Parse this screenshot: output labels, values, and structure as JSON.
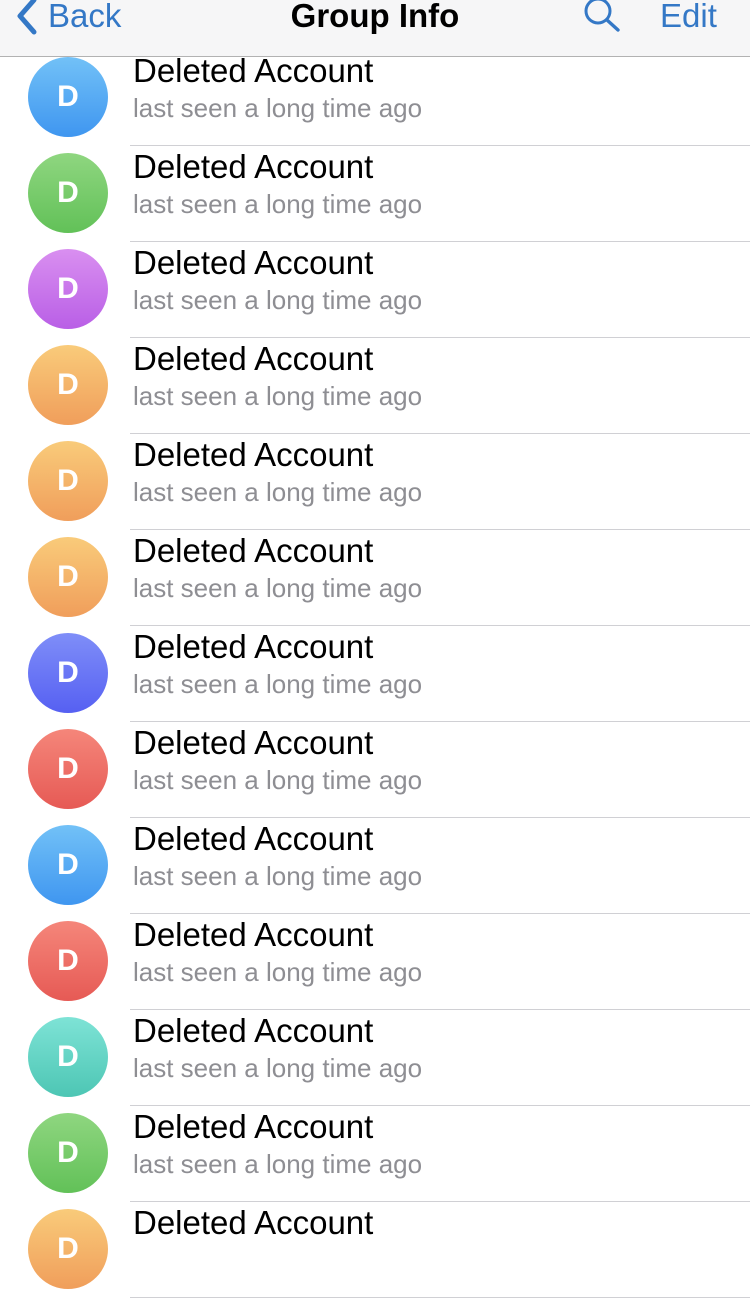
{
  "navbar": {
    "back_label": "Back",
    "title": "Group Info",
    "edit_label": "Edit",
    "accent_color": "#3478c6",
    "icons": {
      "back": "chevron-left-icon",
      "search": "search-icon"
    }
  },
  "members": [
    {
      "initial": "D",
      "name": "Deleted Account",
      "status": "last seen a long time ago",
      "color_top": "#72c1f7",
      "color_bottom": "#3f96f0"
    },
    {
      "initial": "D",
      "name": "Deleted Account",
      "status": "last seen a long time ago",
      "color_top": "#8fd680",
      "color_bottom": "#62c158"
    },
    {
      "initial": "D",
      "name": "Deleted Account",
      "status": "last seen a long time ago",
      "color_top": "#d98ff0",
      "color_bottom": "#b95fe6"
    },
    {
      "initial": "D",
      "name": "Deleted Account",
      "status": "last seen a long time ago",
      "color_top": "#f9cb7a",
      "color_bottom": "#f09e5b"
    },
    {
      "initial": "D",
      "name": "Deleted Account",
      "status": "last seen a long time ago",
      "color_top": "#f9cb7a",
      "color_bottom": "#f09e5b"
    },
    {
      "initial": "D",
      "name": "Deleted Account",
      "status": "last seen a long time ago",
      "color_top": "#f9cb7a",
      "color_bottom": "#f09e5b"
    },
    {
      "initial": "D",
      "name": "Deleted Account",
      "status": "last seen a long time ago",
      "color_top": "#7f8ef8",
      "color_bottom": "#5660f2"
    },
    {
      "initial": "D",
      "name": "Deleted Account",
      "status": "last seen a long time ago",
      "color_top": "#f5867a",
      "color_bottom": "#e65a55"
    },
    {
      "initial": "D",
      "name": "Deleted Account",
      "status": "last seen a long time ago",
      "color_top": "#72c1f7",
      "color_bottom": "#3f96f0"
    },
    {
      "initial": "D",
      "name": "Deleted Account",
      "status": "last seen a long time ago",
      "color_top": "#f5867a",
      "color_bottom": "#e65a55"
    },
    {
      "initial": "D",
      "name": "Deleted Account",
      "status": "last seen a long time ago",
      "color_top": "#7ee3d6",
      "color_bottom": "#4dc6b4"
    },
    {
      "initial": "D",
      "name": "Deleted Account",
      "status": "last seen a long time ago",
      "color_top": "#8fd680",
      "color_bottom": "#62c158"
    },
    {
      "initial": "D",
      "name": "Deleted Account",
      "status": "",
      "color_top": "#f9cb7a",
      "color_bottom": "#f09e5b"
    }
  ]
}
